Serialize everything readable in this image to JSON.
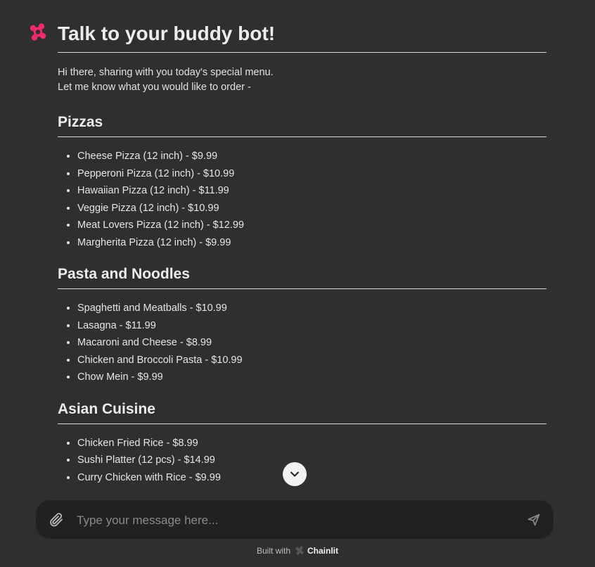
{
  "colors": {
    "background": "#2f2f2f",
    "composer": "#212121",
    "accent": "#f0286e",
    "text": "#e8e8e8"
  },
  "bot": {
    "avatar_icon": "chainlit-logo-icon"
  },
  "message": {
    "title": "Talk to your buddy bot!",
    "intro_line1": "Hi there, sharing with you today's special menu.",
    "intro_line2": "Let me know what you would like to order -",
    "sections": [
      {
        "heading": "Pizzas",
        "items": [
          "Cheese Pizza (12 inch) - $9.99",
          "Pepperoni Pizza (12 inch) - $10.99",
          "Hawaiian Pizza (12 inch) - $11.99",
          "Veggie Pizza (12 inch) - $10.99",
          "Meat Lovers Pizza (12 inch) - $12.99",
          "Margherita Pizza (12 inch) - $9.99"
        ]
      },
      {
        "heading": "Pasta and Noodles",
        "items": [
          "Spaghetti and Meatballs - $10.99",
          "Lasagna - $11.99",
          "Macaroni and Cheese - $8.99",
          "Chicken and Broccoli Pasta - $10.99",
          "Chow Mein - $9.99"
        ]
      },
      {
        "heading": "Asian Cuisine",
        "items": [
          "Chicken Fried Rice - $8.99",
          "Sushi Platter (12 pcs) - $14.99",
          "Curry Chicken with Rice - $9.99"
        ]
      }
    ]
  },
  "scroll_button": {
    "icon": "chevron-down-icon"
  },
  "composer": {
    "placeholder": "Type your message here...",
    "value": "",
    "attach_icon": "paperclip-icon",
    "send_icon": "send-icon"
  },
  "footer": {
    "built_with": "Built with",
    "brand": "Chainlit"
  }
}
